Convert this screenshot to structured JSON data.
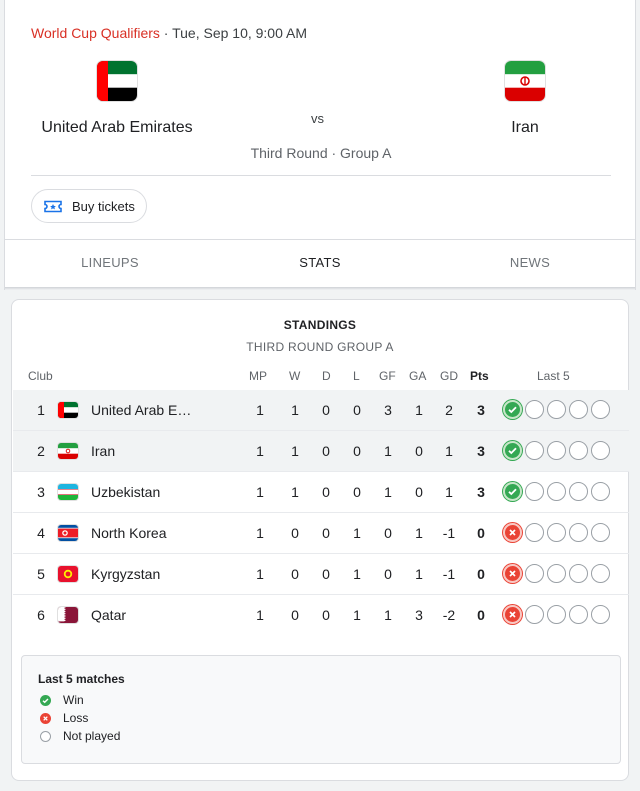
{
  "match": {
    "competition": "World Cup Qualifiers",
    "datetime": " · Tue, Sep 10, 9:00 AM",
    "home_team": "United Arab Emirates",
    "away_team": "Iran",
    "vs": "vs",
    "round": "Third Round · Group A",
    "buy_tickets": "Buy tickets"
  },
  "tabs": [
    "LINEUPS",
    "STATS",
    "NEWS"
  ],
  "active_tab": "STATS",
  "standings": {
    "title": "STANDINGS",
    "subtitle": "THIRD ROUND GROUP A",
    "headers": {
      "club": "Club",
      "mp": "MP",
      "w": "W",
      "d": "D",
      "l": "L",
      "gf": "GF",
      "ga": "GA",
      "gd": "GD",
      "pts": "Pts",
      "last5": "Last 5"
    },
    "rows": [
      {
        "pos": "1",
        "team": "United Arab E…",
        "mp": "1",
        "w": "1",
        "d": "0",
        "l": "0",
        "gf": "3",
        "ga": "1",
        "gd": "2",
        "pts": "3",
        "last5": [
          "win",
          "np",
          "np",
          "np",
          "np"
        ]
      },
      {
        "pos": "2",
        "team": "Iran",
        "mp": "1",
        "w": "1",
        "d": "0",
        "l": "0",
        "gf": "1",
        "ga": "0",
        "gd": "1",
        "pts": "3",
        "last5": [
          "win",
          "np",
          "np",
          "np",
          "np"
        ]
      },
      {
        "pos": "3",
        "team": "Uzbekistan",
        "mp": "1",
        "w": "1",
        "d": "0",
        "l": "0",
        "gf": "1",
        "ga": "0",
        "gd": "1",
        "pts": "3",
        "last5": [
          "win",
          "np",
          "np",
          "np",
          "np"
        ]
      },
      {
        "pos": "4",
        "team": "North Korea",
        "mp": "1",
        "w": "0",
        "d": "0",
        "l": "1",
        "gf": "0",
        "ga": "1",
        "gd": "-1",
        "pts": "0",
        "last5": [
          "loss",
          "np",
          "np",
          "np",
          "np"
        ]
      },
      {
        "pos": "5",
        "team": "Kyrgyzstan",
        "mp": "1",
        "w": "0",
        "d": "0",
        "l": "1",
        "gf": "0",
        "ga": "1",
        "gd": "-1",
        "pts": "0",
        "last5": [
          "loss",
          "np",
          "np",
          "np",
          "np"
        ]
      },
      {
        "pos": "6",
        "team": "Qatar",
        "mp": "1",
        "w": "0",
        "d": "0",
        "l": "1",
        "gf": "1",
        "ga": "3",
        "gd": "-2",
        "pts": "0",
        "last5": [
          "loss",
          "np",
          "np",
          "np",
          "np"
        ]
      }
    ]
  },
  "legend": {
    "title": "Last 5 matches",
    "win": "Win",
    "loss": "Loss",
    "not_played": "Not played"
  },
  "colors": {
    "competition": "#d93025",
    "win": "#34a853",
    "loss": "#ea4335",
    "not_played": "#9aa0a6"
  },
  "icons": {
    "buy_tickets": "ticket-icon",
    "win": "check-icon",
    "loss": "close-icon"
  }
}
